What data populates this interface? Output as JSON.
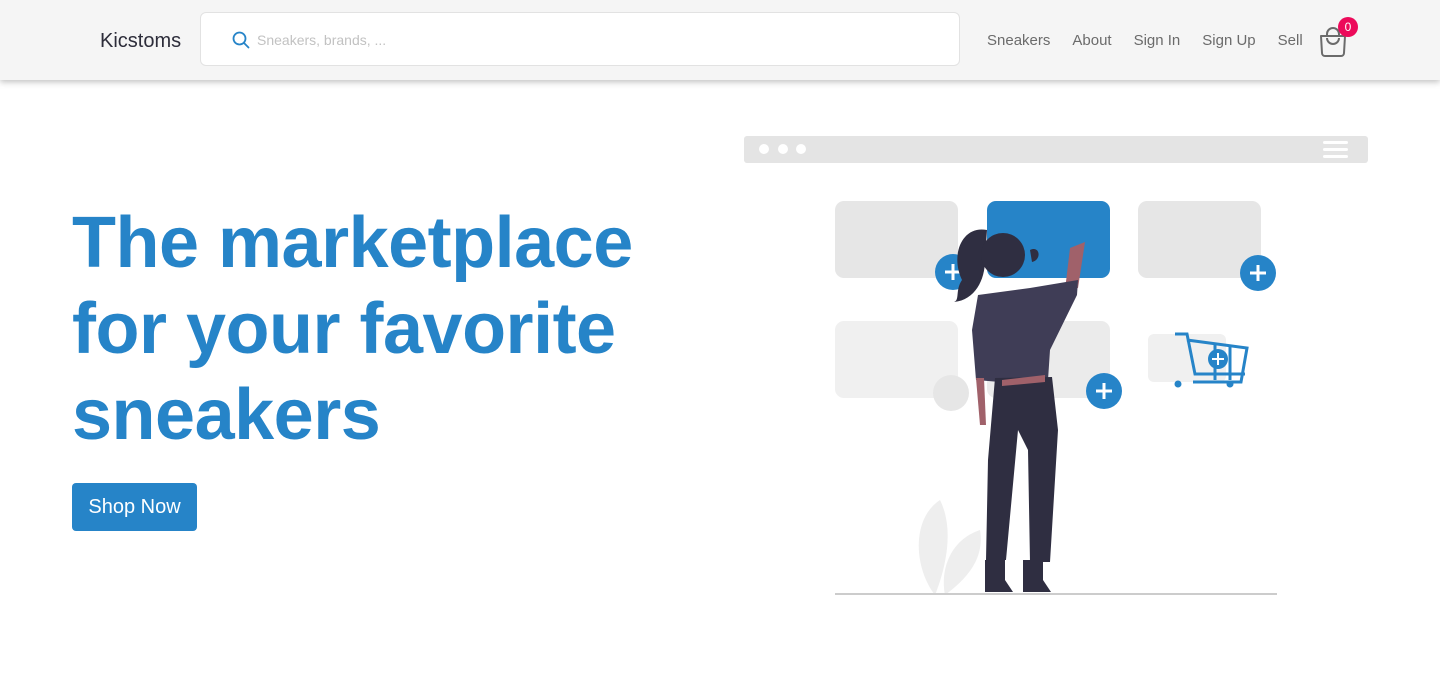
{
  "header": {
    "brand": "Kicstoms",
    "search": {
      "placeholder": "Sneakers, brands, ...",
      "value": ""
    },
    "nav_items": [
      {
        "label": "Sneakers"
      },
      {
        "label": "About"
      },
      {
        "label": "Sign In"
      },
      {
        "label": "Sign Up"
      },
      {
        "label": "Sell"
      }
    ],
    "cart": {
      "icon": "shopping-bag-icon",
      "count": "0"
    }
  },
  "hero": {
    "title": "The marketplace for your favorite sneakers",
    "cta_label": "Shop Now"
  },
  "colors": {
    "accent": "#2684c8",
    "badge": "#ec0a5a",
    "navbar_bg": "#f5f5f5",
    "text_dark": "#2d2d3a",
    "nav_text": "#6b6b6b"
  },
  "illustration": {
    "description": "woman-choosing-product-cards",
    "icons": [
      "browser-window",
      "menu-icon",
      "plus-icon",
      "shopping-cart-icon",
      "person",
      "plant"
    ]
  }
}
